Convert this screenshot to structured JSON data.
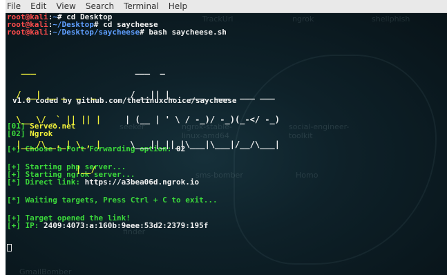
{
  "menu": {
    "items": [
      "File",
      "Edit",
      "View",
      "Search",
      "Terminal",
      "Help"
    ]
  },
  "prompt": {
    "user": "root@kali",
    "sep": ":",
    "path1": "~",
    "path2": "~/Desktop",
    "path3": "~/Desktop/saycheese",
    "hash": "# ",
    "cmd1": "cd Desktop",
    "cmd2": "cd saycheese",
    "cmd3": "bash saycheese.sh"
  },
  "banner": {
    "art_say": [
      "  ___                ",
      " / __| __ _  _  _    ",
      " \\__ \\/ _` || || |   ",
      " |___/\\__,_| \\_, |   ",
      "             |__/    "
    ],
    "art_cheese": [
      "  ___  _                         ",
      " / __|| |_   ___  ___  ___ ___   ",
      "| (__ | ' \\ / -_)/ -_)(_-</ -_)  ",
      " \\___||_||_|\\___|\\___|/__/\\___|  ",
      "                                 "
    ],
    "credit": "v1.0 coded by github.com/thelinuxchoice/saycheese"
  },
  "options": [
    {
      "num": "[01]",
      "label": "Serveo.net"
    },
    {
      "num": "[02]",
      "label": "Ngrok"
    }
  ],
  "choose_prefix": "[+]",
  "choose_text": "Choose a Port Forwarding option: ",
  "choose_value": "02",
  "start_php_prefix": "[+]",
  "start_php": "Starting php server...",
  "start_ngrok_prefix": "[+]",
  "start_ngrok": "Starting ngrok server...",
  "direct_prefix": "[*]",
  "direct_label": "Direct link: ",
  "direct_url": "https://a3bea06d.ngrok.io",
  "waiting_prefix": "[*]",
  "waiting_text": "Waiting targets, Press Ctrl + C to exit...",
  "opened_prefix": "[+]",
  "opened_text": "Target opened the link!",
  "ip_prefix": "[+]",
  "ip_label": "IP: ",
  "ip_value": "2409:4073:a:160b:9eee:53d2:2379:195f",
  "background_labels": [
    "TrackUrl",
    "ngrok",
    "shellphish",
    "seeker",
    "ngrok-stable-linux-amd64",
    "social-engineer-toolkit",
    "sms-bomber",
    "Homo",
    "GmailBomber",
    "finder"
  ]
}
